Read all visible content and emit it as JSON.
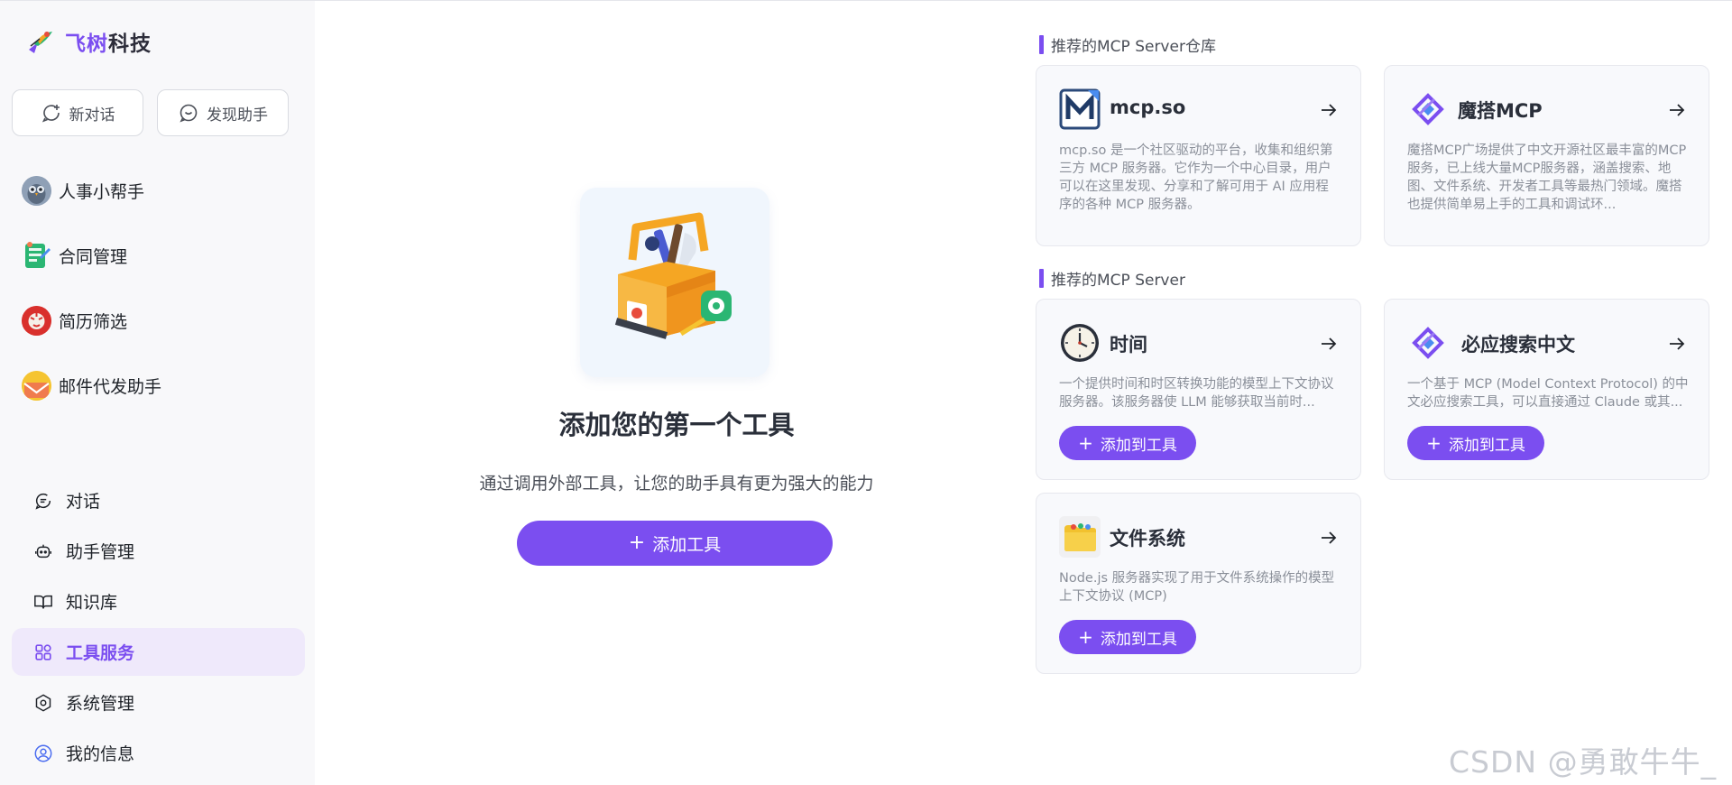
{
  "brand": {
    "name_highlight": "飞树",
    "name_rest": "科技"
  },
  "sidebar": {
    "new_chat_label": "新对话",
    "discover_label": "发现助手",
    "assistants": [
      {
        "name": "人事小帮手",
        "icon": "owl-avatar"
      },
      {
        "name": "合同管理",
        "icon": "contract-avatar"
      },
      {
        "name": "简历筛选",
        "icon": "tiger-avatar"
      },
      {
        "name": "邮件代发助手",
        "icon": "mail-avatar"
      }
    ],
    "nav": [
      {
        "label": "对话",
        "icon": "chat-bubble-icon"
      },
      {
        "label": "助手管理",
        "icon": "robot-icon"
      },
      {
        "label": "知识库",
        "icon": "book-icon"
      },
      {
        "label": "工具服务",
        "icon": "grid-icon",
        "active": true
      },
      {
        "label": "系统管理",
        "icon": "hexagon-gear-icon"
      },
      {
        "label": "我的信息",
        "icon": "user-circle-icon"
      }
    ]
  },
  "main": {
    "title": "添加您的第一个工具",
    "subtitle": "通过调用外部工具，让您的助手具有更为强大的能力",
    "add_button": "添加工具",
    "add_button_icon": "+"
  },
  "right": {
    "repo_section_title": "推荐的MCP Server仓库",
    "server_section_title": "推荐的MCP Server",
    "repos": [
      {
        "title": "mcp.so",
        "icon": "mcp-so-logo",
        "desc": "mcp.so 是一个社区驱动的平台，收集和组织第三方 MCP 服务器。它作为一个中心目录，用户可以在这里发现、分享和了解可用于 AI 应用程序的各种 MCP 服务器。"
      },
      {
        "title": "魔搭MCP",
        "icon": "modelscope-logo",
        "desc": "魔搭MCP广场提供了中文开源社区最丰富的MCP服务，已上线大量MCP服务器，涵盖搜索、地图、文件系统、开发者工具等最热门领域。魔搭也提供简单易上手的工具和调试环..."
      }
    ],
    "servers": [
      {
        "title": "时间",
        "icon": "clock-logo",
        "desc": "一个提供时间和时区转换功能的模型上下文协议服务器。该服务器使 LLM 能够获取当前时...",
        "add_label": "添加到工具"
      },
      {
        "title": "必应搜索中文",
        "icon": "bing-logo",
        "desc": "一个基于 MCP (Model Context Protocol) 的中文必应搜索工具，可以直接通过 Claude 或其...",
        "add_label": "添加到工具"
      },
      {
        "title": "文件系统",
        "icon": "folder-logo",
        "desc": "Node.js 服务器实现了用于文件系统操作的模型上下文协议 (MCP)",
        "add_label": "添加到工具"
      }
    ]
  },
  "watermark": "CSDN @勇敢牛牛_",
  "colors": {
    "accent": "#7b4ef0",
    "active_bg": "#efe9fb",
    "sidebar_bg": "#f8f8fa"
  }
}
